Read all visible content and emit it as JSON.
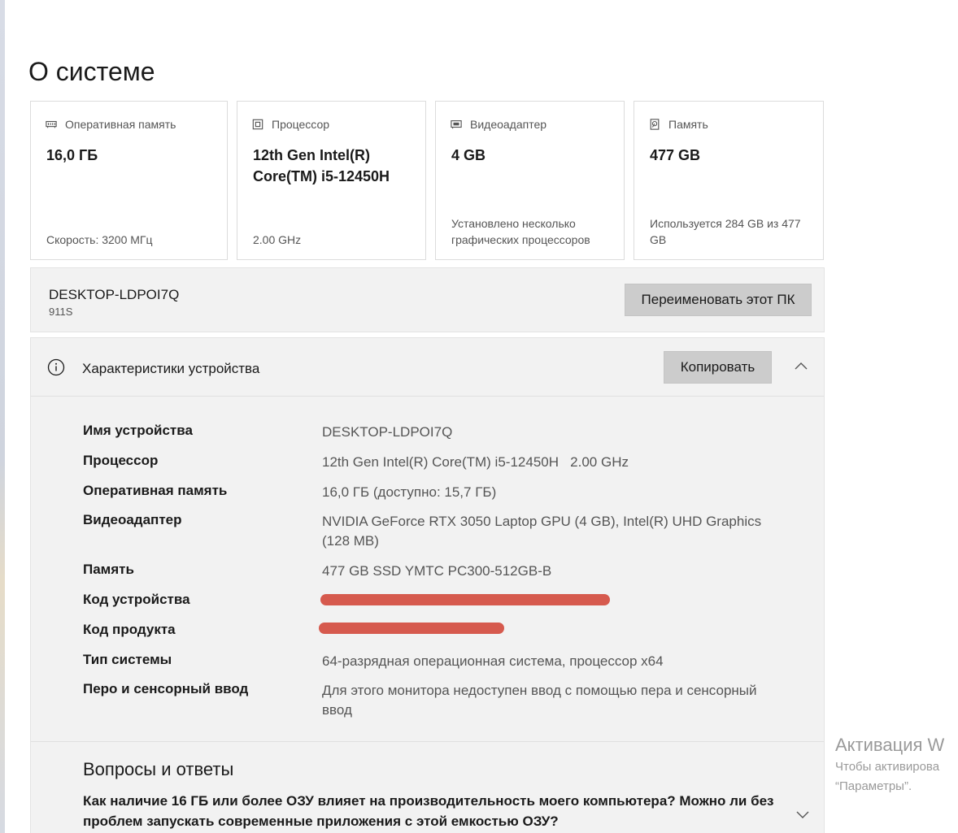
{
  "page": {
    "title": "О системе"
  },
  "cards": [
    {
      "icon": "memory-icon",
      "label": "Оперативная память",
      "value": "16,0 ГБ",
      "footer": "Скорость: 3200 МГц"
    },
    {
      "icon": "cpu-icon",
      "label": "Процессор",
      "value": "12th Gen Intel(R) Core(TM) i5-12450H",
      "footer": "2.00 GHz"
    },
    {
      "icon": "gpu-icon",
      "label": "Видеоадаптер",
      "value": "4 GB",
      "footer": "Установлено несколько графических процессоров"
    },
    {
      "icon": "storage-icon",
      "label": "Память",
      "value": "477 GB",
      "footer": "Используется 284 GB из 477 GB"
    }
  ],
  "pc": {
    "name": "DESKTOP-LDPOI7Q",
    "model": "911S",
    "rename_label": "Переименовать этот ПК"
  },
  "specs": {
    "title": "Характеристики устройства",
    "copy_label": "Копировать",
    "rows": [
      {
        "label": "Имя устройства",
        "value": "DESKTOP-LDPOI7Q"
      },
      {
        "label": "Процессор",
        "value": "12th Gen Intel(R) Core(TM) i5-12450H   2.00 GHz"
      },
      {
        "label": "Оперативная память",
        "value": "16,0 ГБ (доступно: 15,7 ГБ)"
      },
      {
        "label": "Видеоадаптер",
        "value": "NVIDIA GeForce RTX 3050 Laptop GPU (4 GB), Intel(R) UHD Graphics (128 MB)"
      },
      {
        "label": "Память",
        "value": "477 GB SSD YMTC PC300-512GB-B"
      },
      {
        "label": "Код устройства",
        "value": ""
      },
      {
        "label": "Код продукта",
        "value": ""
      },
      {
        "label": "Тип системы",
        "value": "64-разрядная операционная система, процессор x64"
      },
      {
        "label": "Перо и сенсорный ввод",
        "value": "Для этого монитора недоступен ввод с помощью пера и сенсорный ввод"
      }
    ]
  },
  "faq": {
    "title": "Вопросы и ответы",
    "question": "Как наличие 16 ГБ или более ОЗУ влияет на производительность моего компьютера? Можно ли без проблем запускать современные приложения с этой емкостью ОЗУ?"
  },
  "watermark": {
    "title": "Активация W",
    "line1": "Чтобы активирова",
    "line2": "“Параметры”."
  },
  "colors": {
    "redaction": "#d65a4e",
    "button": "#cccccc",
    "panel": "#f2f2f2"
  }
}
